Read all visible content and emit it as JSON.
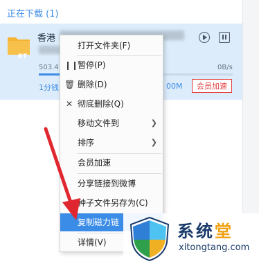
{
  "section": {
    "title": "正在下载 (1)"
  },
  "task": {
    "name_visible": "香港",
    "size_text": "503.41",
    "speed": "0B/s",
    "eta": "1分钱",
    "eta_right": "00M",
    "progress": 0.62,
    "member_boost": "会员加速",
    "bt_badge": "BT"
  },
  "context_menu": {
    "items": [
      {
        "label": "打开文件夹(F)",
        "icon": "",
        "submenu": false
      },
      {
        "label": "暂停(P)",
        "icon": "pause-icon",
        "submenu": false
      },
      {
        "label": "删除(D)",
        "icon": "trash-icon",
        "submenu": false
      },
      {
        "label": "彻底删除(Q)",
        "icon": "close-icon",
        "submenu": false
      },
      {
        "label": "移动文件到",
        "icon": "",
        "submenu": true
      },
      {
        "label": "排序",
        "icon": "",
        "submenu": true
      },
      {
        "label": "会员加速",
        "icon": "",
        "submenu": false
      },
      {
        "label": "分享链接到微博",
        "icon": "",
        "submenu": false
      },
      {
        "label": "种子文件另存为(C)",
        "icon": "",
        "submenu": false
      },
      {
        "label": "复制磁力链",
        "icon": "",
        "submenu": false,
        "highlighted": true
      },
      {
        "label": "详情(V)",
        "icon": "",
        "submenu": false
      }
    ]
  },
  "watermark": {
    "title_a": "系统",
    "title_b": "堂",
    "url": "xitongtang.com"
  },
  "colors": {
    "accent": "#3b8ce6",
    "selection_bg": "#dcecfb",
    "highlight_text": "#ffffff",
    "member_red": "#e23c3c",
    "arrow_red": "#e0262f"
  }
}
